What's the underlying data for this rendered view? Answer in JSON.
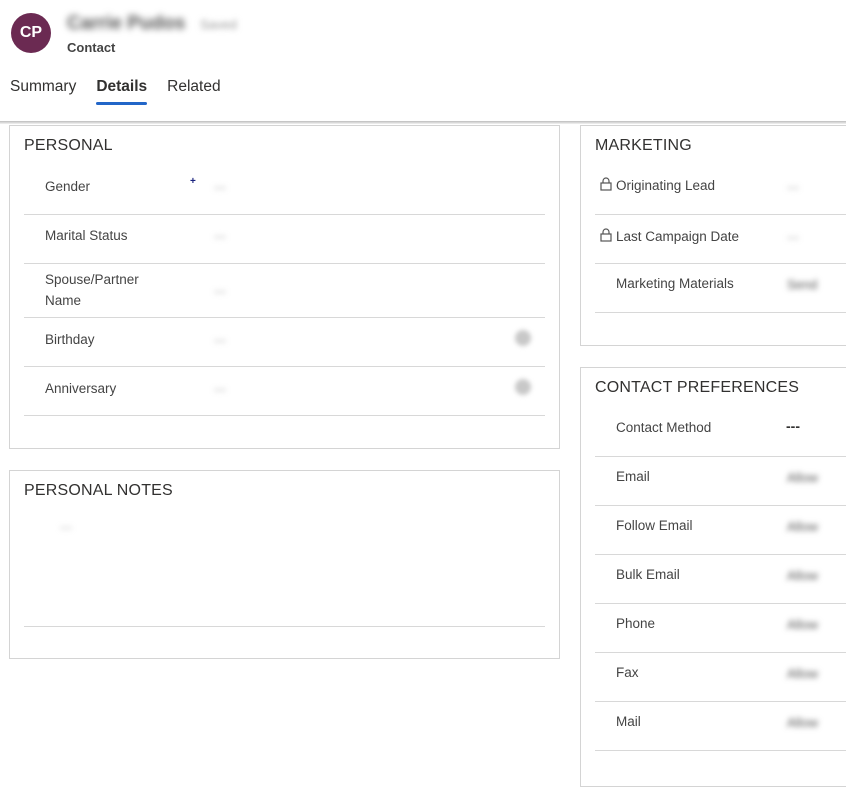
{
  "header": {
    "avatar_initials": "CP",
    "avatar_color": "#6b2a52",
    "record_name": "Carrie Pudos",
    "save_status": "Saved",
    "entity_type": "Contact"
  },
  "tabs": [
    {
      "label": "Summary",
      "active": false
    },
    {
      "label": "Details",
      "active": true
    },
    {
      "label": "Related",
      "active": false
    }
  ],
  "accent_color": "#2266c8",
  "personal": {
    "title": "PERSONAL",
    "required_marker": "+",
    "fields": [
      {
        "label": "Gender",
        "value": "---"
      },
      {
        "label": "Marital Status",
        "value": "---"
      },
      {
        "label": "Spouse/Partner Name",
        "value": "---"
      },
      {
        "label": "Birthday",
        "value": "---",
        "icon": "calendar-icon"
      },
      {
        "label": "Anniversary",
        "value": "---",
        "icon": "calendar-icon"
      }
    ]
  },
  "personal_notes": {
    "title": "PERSONAL NOTES",
    "value": "---"
  },
  "marketing": {
    "title": "MARKETING",
    "fields": [
      {
        "label": "Originating Lead",
        "value": "---",
        "locked": true
      },
      {
        "label": "Last Campaign Date",
        "value": "---",
        "locked": true
      },
      {
        "label": "Marketing Materials",
        "value": "Send",
        "locked": false
      }
    ]
  },
  "contact_preferences": {
    "title": "CONTACT PREFERENCES",
    "fields": [
      {
        "label": "Contact Method",
        "value": "---"
      },
      {
        "label": "Email",
        "value": "Allow"
      },
      {
        "label": "Follow Email",
        "value": "Allow"
      },
      {
        "label": "Bulk Email",
        "value": "Allow"
      },
      {
        "label": "Phone",
        "value": "Allow"
      },
      {
        "label": "Fax",
        "value": "Allow"
      },
      {
        "label": "Mail",
        "value": "Allow"
      }
    ]
  }
}
